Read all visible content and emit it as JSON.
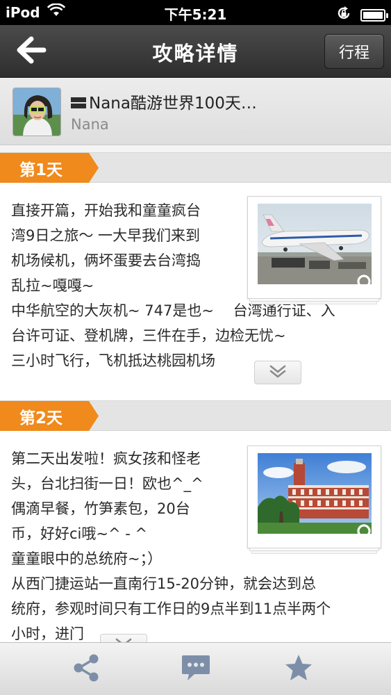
{
  "status_bar": {
    "carrier": "iPod",
    "time": "下午5:21"
  },
  "nav": {
    "title": "攻略详情",
    "itinerary_label": "行程"
  },
  "author": {
    "guide_title": "Nana酷游世界100天…",
    "name": "Nana"
  },
  "days": [
    {
      "label": "第1天",
      "lines": [
        "直接开篇，开始我和童童疯台",
        "湾9日之旅～ 一大早我们来到",
        "机场候机，俩坏蛋要去台湾捣",
        "乱拉~嘎嘎~",
        "中华航空的大灰机~ 747是也~　  台湾通行证、入",
        "台许可证、登机牌，三件在手，边检无忧~",
        "三小时飞行，飞机抵达桃园机场"
      ]
    },
    {
      "label": "第2天",
      "lines": [
        "第二天出发啦！疯女孩和怪老",
        "头，台北扫街一日！欧也^_^",
        "偶滴早餐，竹笋素包，20台",
        "币，好好ci哦~^ - ^",
        "童童眼中的总统府~；）",
        " 从西门捷运站一直南行15-20分钟，就会达到总",
        "统府，参观时间只有工作日的9点半到11点半两个",
        "小时，进门"
      ]
    }
  ],
  "toolbar": {
    "icons": [
      "share-icon",
      "comment-icon",
      "star-icon"
    ]
  },
  "colors": {
    "accent_orange": "#f08a1c",
    "navbar": "#3a3a3a",
    "toolbar_icon": "#7d8fa8"
  }
}
